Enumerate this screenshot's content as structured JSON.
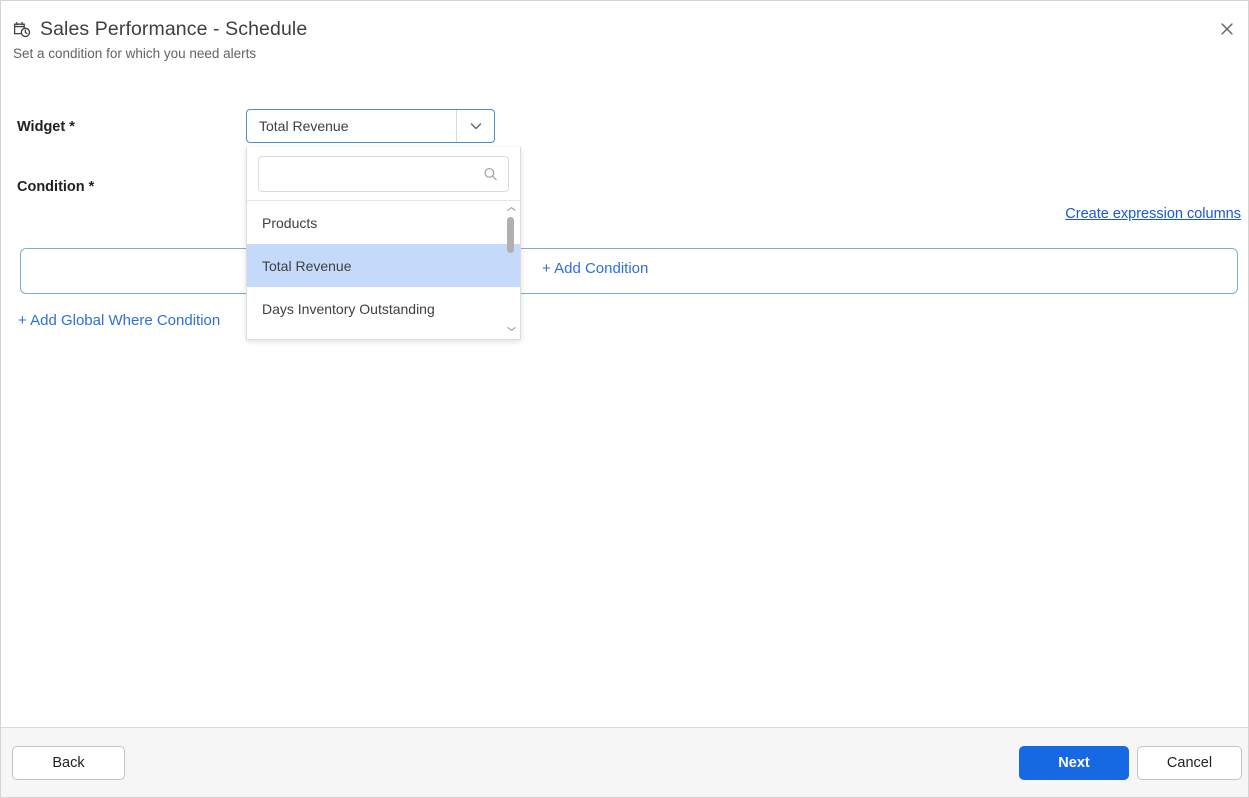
{
  "dialog": {
    "title": "Sales Performance - Schedule",
    "subtitle": "Set a condition for which you need alerts",
    "title_icon": "calendar-clock-icon",
    "close_icon": "close-icon"
  },
  "form": {
    "widget": {
      "label": "Widget *",
      "selected_value": "Total Revenue",
      "chevron_icon": "chevron-down-icon"
    },
    "condition": {
      "label": "Condition *",
      "add_condition_label": "+ Add Condition",
      "add_global_where_label": "+ Add Global Where Condition",
      "create_expression_label": "Create expression columns"
    }
  },
  "dropdown": {
    "search": {
      "value": "",
      "placeholder": "",
      "icon": "search-icon"
    },
    "options": [
      {
        "label": "Products",
        "selected": false
      },
      {
        "label": "Total Revenue",
        "selected": true
      },
      {
        "label": "Days Inventory Outstanding",
        "selected": false
      }
    ],
    "scrollbar": {
      "up_icon": "chevron-up-icon",
      "down_icon": "chevron-down-icon"
    }
  },
  "footer": {
    "back_label": "Back",
    "next_label": "Next",
    "cancel_label": "Cancel"
  },
  "colors": {
    "primary": "#1668e3",
    "link": "#2b6fe0",
    "link_underlined": "#1a56d6",
    "option_selected_bg": "#c5dafb",
    "field_border_focus": "#4a90c4",
    "condition_border": "#78b0cf"
  }
}
